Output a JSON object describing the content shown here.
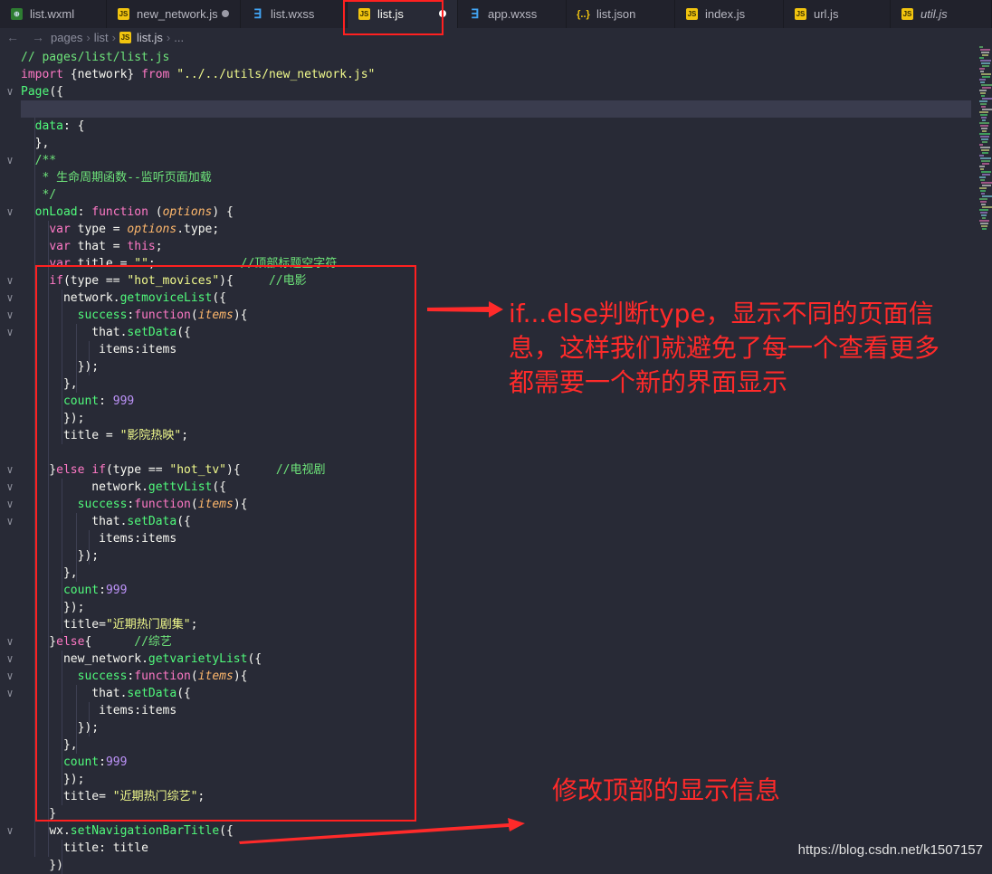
{
  "tabs": [
    {
      "label": "list.wxml",
      "icon": "wxml-icon",
      "active": false,
      "modified": false,
      "italic": false
    },
    {
      "label": "new_network.js",
      "icon": "js-icon",
      "active": false,
      "modified": true,
      "italic": false
    },
    {
      "label": "list.wxss",
      "icon": "css-icon",
      "active": false,
      "modified": false,
      "italic": false
    },
    {
      "label": "list.js",
      "icon": "js-icon",
      "active": true,
      "modified": true,
      "italic": false
    },
    {
      "label": "app.wxss",
      "icon": "css-icon",
      "active": false,
      "modified": false,
      "italic": false
    },
    {
      "label": "list.json",
      "icon": "json-icon",
      "active": false,
      "modified": false,
      "italic": false
    },
    {
      "label": "index.js",
      "icon": "js-icon",
      "active": false,
      "modified": false,
      "italic": false
    },
    {
      "label": "url.js",
      "icon": "js-icon",
      "active": false,
      "modified": false,
      "italic": false
    },
    {
      "label": "util.js",
      "icon": "js-icon",
      "active": false,
      "modified": false,
      "italic": true
    }
  ],
  "breadcrumb": {
    "back": "←",
    "forward": "→",
    "parts": [
      "pages",
      "list",
      "list.js",
      "..."
    ]
  },
  "code_lines": [
    "// pages/list/list.js",
    "import {network} from \"../../utils/new_network.js\"",
    "Page({",
    "",
    "  data: {",
    "  },",
    "  /**",
    "   * 生命周期函数--监听页面加载",
    "   */",
    "  onLoad: function (options) {",
    "    var type = options.type;",
    "    var that = this;",
    "    var title = \"\";            //顶部标题空字符",
    "    if(type == \"hot_movices\"){     //电影",
    "      network.getmoviceList({",
    "        success:function(items){",
    "          that.setData({",
    "           items:items",
    "        });",
    "      },",
    "      count: 999",
    "      });",
    "      title = \"影院热映\";",
    "",
    "    }else if(type == \"hot_tv\"){     //电视剧",
    "          network.gettvList({",
    "        success:function(items){",
    "          that.setData({",
    "           items:items",
    "        });",
    "      },",
    "      count:999",
    "      });",
    "      title=\"近期热门剧集\";",
    "    }else{      //综艺",
    "      new_network.getvarietyList({",
    "        success:function(items){",
    "          that.setData({",
    "           items:items",
    "        });",
    "      },",
    "      count:999",
    "      });",
    "      title= \"近期热门综艺\";",
    "    }",
    "    wx.setNavigationBarTitle({",
    "      title: title",
    "    })"
  ],
  "annotations": {
    "note1": "if...else判断type，显示不同的页面信息，这样我们就避免了每一个查看更多都需要一个新的界面显示",
    "note1_lines": [
      "if...else判断type，显示不同的页面信",
      "息，这样我们就避免了每一个查看更多",
      "都需要一个新的界面显示"
    ],
    "note2": "修改顶部的显示信息"
  },
  "watermark": "https://blog.csdn.net/k1507157",
  "colors": {
    "accent_red": "#ff2a2a",
    "editor_bg": "#282a36",
    "js_icon": "#f1c40f",
    "css_icon": "#42a5f5"
  }
}
